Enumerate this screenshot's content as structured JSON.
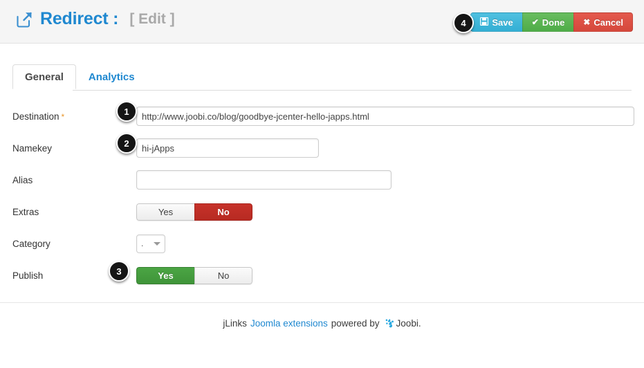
{
  "header": {
    "icon": "external-link-icon",
    "title": "Redirect :",
    "subtitle": "[ Edit ]",
    "buttons": [
      {
        "label": "Save",
        "icon": "floppy-disk-icon",
        "glyph": "💾",
        "color": "#33afd4"
      },
      {
        "label": "Done",
        "icon": "check-icon",
        "glyph": "✔",
        "color": "#4fac48"
      },
      {
        "label": "Cancel",
        "icon": "x-icon",
        "glyph": "✖",
        "color": "#d5483c"
      }
    ]
  },
  "callouts": [
    {
      "number": "1",
      "target": "destination-input"
    },
    {
      "number": "2",
      "target": "namekey-input"
    },
    {
      "number": "3",
      "target": "publish-toggle"
    },
    {
      "number": "4",
      "target": "save-button"
    }
  ],
  "tabs": [
    {
      "label": "General",
      "active": true
    },
    {
      "label": "Analytics",
      "active": false
    }
  ],
  "form": {
    "destination": {
      "label": "Destination",
      "required_marker": "*",
      "value": "http://www.joobi.co/blog/goodbye-jcenter-hello-japps.html",
      "placeholder": ""
    },
    "namekey": {
      "label": "Namekey",
      "value": "hi-jApps",
      "placeholder": ""
    },
    "alias": {
      "label": "Alias",
      "value": "",
      "placeholder": ""
    },
    "extras": {
      "label": "Extras",
      "yes_label": "Yes",
      "no_label": "No",
      "selected": "No"
    },
    "category": {
      "label": "Category",
      "selected": ".",
      "options": [
        "."
      ]
    },
    "publish": {
      "label": "Publish",
      "yes_label": "Yes",
      "no_label": "No",
      "selected": "Yes"
    }
  },
  "footer": {
    "prefix": "jLinks",
    "link": "Joomla extensions",
    "middle": "powered by",
    "brand": "Joobi.",
    "logo_icon": "joobi-logo-icon"
  },
  "colors": {
    "accent_blue": "#1f88d0",
    "save_blue": "#33afd4",
    "done_green": "#4fac48",
    "cancel_red": "#d5483c",
    "toggle_on_green": "#4ba544",
    "toggle_on_red": "#c6322a",
    "required_orange": "#e8952a"
  }
}
